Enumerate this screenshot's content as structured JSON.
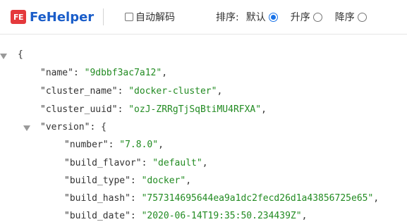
{
  "toolbar": {
    "logo_badge": "FE",
    "logo_text": "FeHelper",
    "auto_decode_label": "自动解码",
    "sort_label": "排序:",
    "sort_options": [
      {
        "label": "默认",
        "checked": true
      },
      {
        "label": "升序",
        "checked": false
      },
      {
        "label": "降序",
        "checked": false
      }
    ]
  },
  "json": {
    "open_brace": "{",
    "name_key": "\"name\"",
    "name_value": "\"9dbbf3ac7a12\"",
    "cluster_name_key": "\"cluster_name\"",
    "cluster_name_value": "\"docker-cluster\"",
    "cluster_uuid_key": "\"cluster_uuid\"",
    "cluster_uuid_value": "\"ozJ-ZRRgTjSqBtiMU4RFXA\"",
    "version_key": "\"version\"",
    "version_open": "{",
    "number_key": "\"number\"",
    "number_value": "\"7.8.0\"",
    "build_flavor_key": "\"build_flavor\"",
    "build_flavor_value": "\"default\"",
    "build_type_key": "\"build_type\"",
    "build_type_value": "\"docker\"",
    "build_hash_key": "\"build_hash\"",
    "build_hash_value": "\"757314695644ea9a1dc2fecd26d1a43856725e65\"",
    "build_date_key": "\"build_date\"",
    "build_date_value": "\"2020-06-14T19:35:50.234439Z\""
  },
  "colors": {
    "string": "#228b22",
    "key": "#333333",
    "accent": "#1a73e8",
    "logo_badge": "#e4393c",
    "logo_text": "#1a5dc9"
  }
}
